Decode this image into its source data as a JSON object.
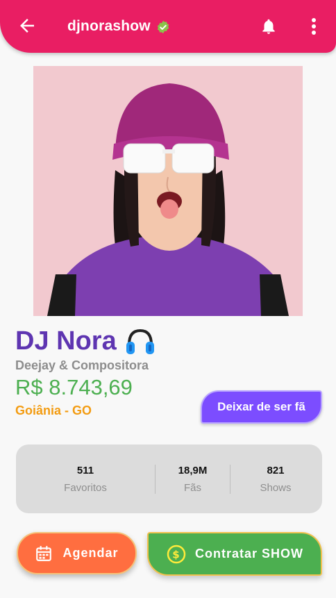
{
  "header": {
    "username": "djnorashow",
    "accent_color": "#e91e63",
    "icons": [
      "back-arrow-icon",
      "verified-badge-icon",
      "notification-bell-icon",
      "more-vert-icon"
    ]
  },
  "profile": {
    "name": "DJ Nora",
    "name_icon": "headphones-icon",
    "role": "Deejay & Compositora",
    "price": "R$ 8.743,69",
    "location": "Goiânia - GO",
    "unfan_button_label": "Deixar de ser fã"
  },
  "stats": [
    {
      "value": "511",
      "label": "Favoritos"
    },
    {
      "value": "18,9M",
      "label": "Fãs"
    },
    {
      "value": "821",
      "label": "Shows"
    }
  ],
  "actions": {
    "schedule_label": "Agendar",
    "schedule_icon": "calendar-icon",
    "hire_label": "Contratar SHOW",
    "hire_icon": "dollar-coin-icon"
  },
  "colors": {
    "name": "#5e35b1",
    "price": "#4caf50",
    "location": "#f39c12",
    "unfan_button": "#7c4dff",
    "schedule_button": "#ff6e40",
    "hire_button": "#4caf50"
  }
}
